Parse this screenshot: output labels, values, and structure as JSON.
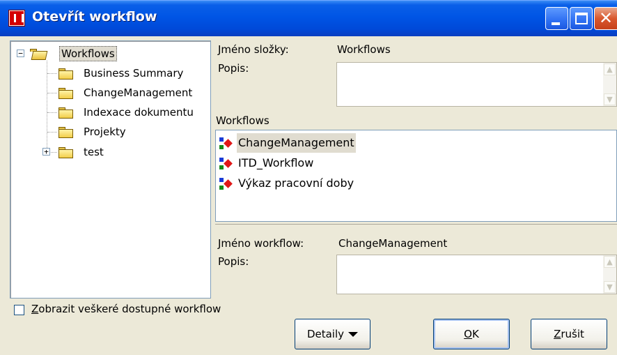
{
  "window": {
    "title": "Otevřít workflow"
  },
  "tree": {
    "root": "Workflows",
    "children": [
      {
        "label": "Business Summary"
      },
      {
        "label": "ChangeManagement"
      },
      {
        "label": "Indexace dokumentu"
      },
      {
        "label": "Projekty"
      },
      {
        "label": "test",
        "expandable": true
      }
    ]
  },
  "folder_info": {
    "name_label": "Jméno složky:",
    "name_value": "Workflows",
    "desc_label": "Popis:",
    "desc_value": ""
  },
  "workflows": {
    "heading": "Workflows",
    "items": [
      {
        "label": "ChangeManagement",
        "selected": true
      },
      {
        "label": "ITD_Workflow"
      },
      {
        "label": "Výkaz pracovní doby"
      }
    ]
  },
  "workflow_info": {
    "name_label": "Jméno workflow:",
    "name_value": "ChangeManagement",
    "desc_label": "Popis:",
    "desc_value": ""
  },
  "show_all": {
    "key": "Z",
    "rest": "obrazit veškeré dostupné workflow",
    "checked": false
  },
  "buttons": {
    "details": "Detaily",
    "ok_key": "O",
    "ok_rest": "K",
    "cancel_key": "Z",
    "cancel_rest": "rušit"
  }
}
